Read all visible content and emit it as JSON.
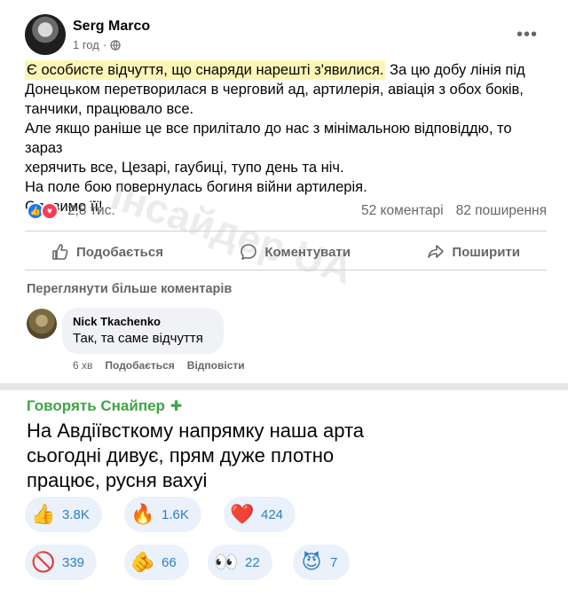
{
  "fb": {
    "author": "Serg Marco",
    "time": "1 год",
    "post_lines": {
      "highlight": "Є особисте відчуття, що снаряди нарешті з'явилися.",
      "l1_rest": " За цю добу лінія під",
      "l2": "Донецьком перетворилася в черговий ад, артилерія, авіація з обох боків,",
      "l3": "танчики, працювало все.",
      "l4": "Але якщо раніше це все прилітало до нас з мінімальною відповіддю, то зараз",
      "l5": "херячить все, Цезарі, гаубиці, тупо день та ніч.",
      "l6": "На поле бою повернулась богиня війни артилерія.",
      "l7": "Славимо її!"
    },
    "reactions_count": "2,8 тис.",
    "comments": "52 коментарі",
    "shares": "82 поширення",
    "actions": {
      "like": "Подобається",
      "comment": "Коментувати",
      "share": "Поширити"
    },
    "more_comments": "Переглянути більше коментарів",
    "comment": {
      "name": "Nick Tkachenko",
      "text": "Так, та саме відчуття",
      "time": "6 хв",
      "like": "Подобається",
      "reply": "Відповісти"
    },
    "watermark": "Інсайдер UA"
  },
  "tg": {
    "author": "Говорять Снайпер",
    "text": "На Авдіївсткому напрямку наша арта сьогодні дивує, прям дуже плотно працює, русня вахуі",
    "reactions": [
      {
        "emoji": "👍",
        "count": "3.8K"
      },
      {
        "emoji": "🔥",
        "count": "1.6K"
      },
      {
        "emoji": "❤️",
        "count": "424"
      },
      {
        "emoji": "🚫",
        "count": "339"
      },
      {
        "emoji": "🫵",
        "count": "66"
      },
      {
        "emoji": "👀",
        "count": "22"
      },
      {
        "emoji": "😈",
        "count": "7"
      }
    ]
  },
  "colors": {
    "fb_blue": "#1877f2",
    "fb_love": "#f33e58",
    "highlight": "#fbf6b7",
    "tg_green": "#3ea543",
    "tg_pill": "#eaf1fa"
  }
}
